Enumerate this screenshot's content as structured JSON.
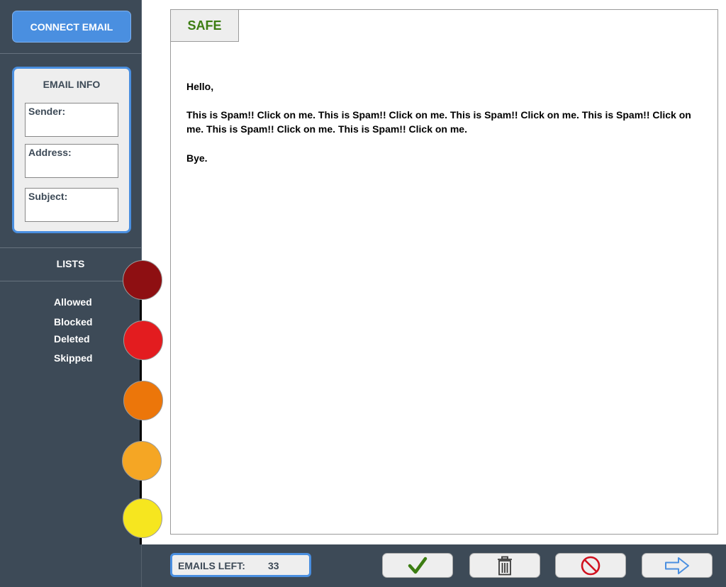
{
  "sidebar": {
    "connect_label": "CONNECT EMAIL",
    "info": {
      "title": "EMAIL INFO",
      "sender_label": "Sender:",
      "address_label": "Address:",
      "subject_label": "Subject:"
    },
    "lists": {
      "title": "LISTS",
      "items": [
        "Allowed",
        "Blocked",
        "Deleted",
        "Skipped"
      ]
    },
    "spam_levels": [
      {
        "icon": "level-1-dot",
        "color": "#8e0f12"
      },
      {
        "icon": "level-2-dot",
        "color": "#e31c1f"
      },
      {
        "icon": "level-3-dot",
        "color": "#ec760a"
      },
      {
        "icon": "level-4-dot",
        "color": "#f5a624"
      },
      {
        "icon": "level-5-dot",
        "color": "#f6e61f"
      }
    ]
  },
  "mail": {
    "status": "SAFE",
    "greeting": "Hello,",
    "body": "This is Spam!! Click on me. This is Spam!! Click on me. This is Spam!! Click on me. This is Spam!! Click on me. This is Spam!! Click on me. This is Spam!! Click on me.",
    "closing": "Bye."
  },
  "footer": {
    "emails_left_label": "EMAILS LEFT:",
    "emails_left_count": "33",
    "actions": [
      {
        "icon": "checkmark-icon",
        "color": "#3c7d12"
      },
      {
        "icon": "trash-icon",
        "color": "#3a3a3a"
      },
      {
        "icon": "block-icon",
        "color": "#d0101e"
      },
      {
        "icon": "arrow-right-icon",
        "color": "#4a8fe0"
      }
    ]
  },
  "colors": {
    "sidebar_bg": "#3d4a57",
    "accent_blue": "#4a8fe0",
    "safe_green": "#3c7d12"
  }
}
